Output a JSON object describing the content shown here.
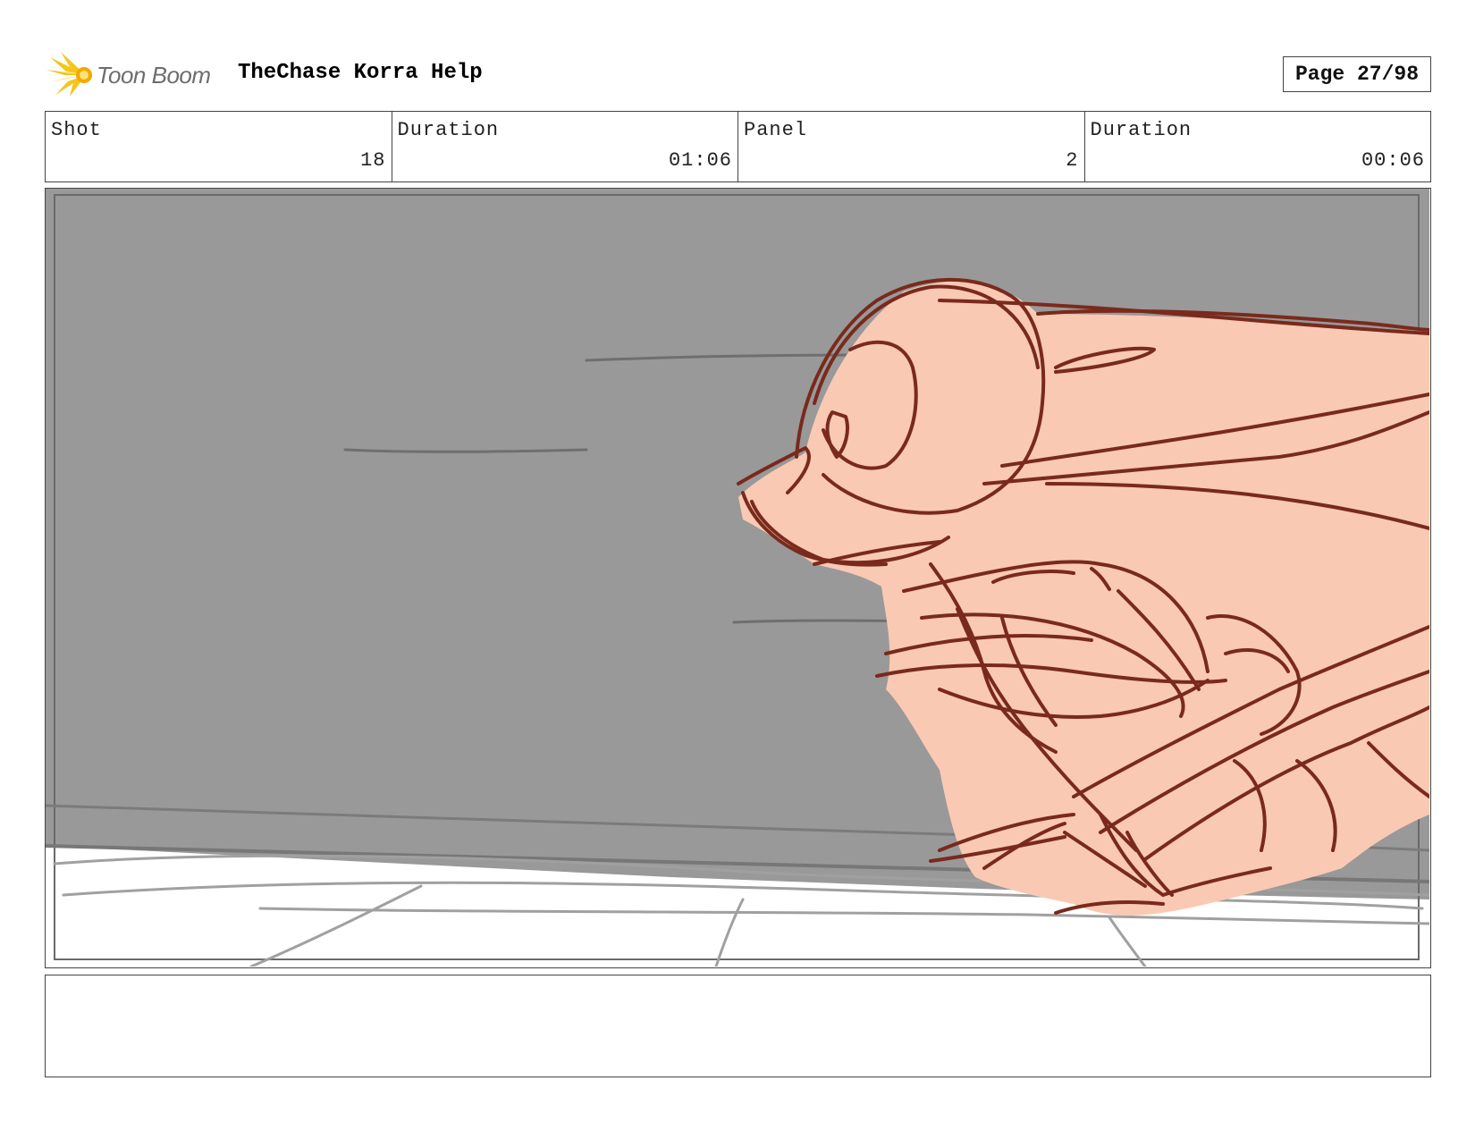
{
  "header": {
    "logo_text": "Toon Boom",
    "title": "TheChase Korra Help",
    "page_label": "Page 27/98"
  },
  "info": [
    {
      "label": "Shot",
      "value": "18"
    },
    {
      "label": "Duration",
      "value": "01:06"
    },
    {
      "label": "Panel",
      "value": "2"
    },
    {
      "label": "Duration",
      "value": "00:06"
    }
  ],
  "colors": {
    "background_wall": "#999999",
    "floor": "#ffffff",
    "creature_fill": "#f9c9b3",
    "creature_line": "#7a2a1c",
    "sketch_line": "#7b7b7b",
    "logo_yellow": "#f5c518"
  },
  "notes": {
    "text": ""
  }
}
